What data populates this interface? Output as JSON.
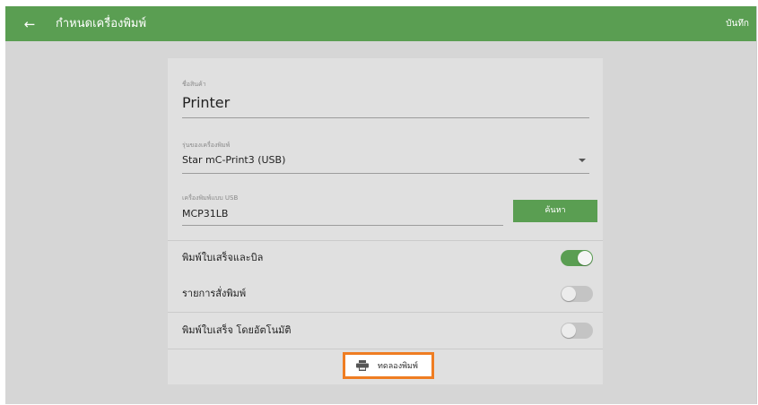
{
  "app_bar": {
    "back_icon": "arrow-left-icon",
    "title": "กำหนดเครื่องพิมพ์",
    "save_label": "บันทึก",
    "color": "#5a9e52"
  },
  "form": {
    "product_name": {
      "label": "ชื่อสินค้า",
      "value": "Printer"
    },
    "printer_model": {
      "label": "รุ่นของเครื่องพิมพ์",
      "value": "Star mC-Print3 (USB)"
    },
    "usb_printer": {
      "label": "เครื่องพิมพ์แบบ USB",
      "value": "MCP31LB",
      "search_label": "ค้นหา"
    }
  },
  "toggles": [
    {
      "label": "พิมพ์ใบเสร็จและบิล",
      "state": "on"
    },
    {
      "label": "รายการสั่งพิมพ์",
      "state": "off"
    },
    {
      "label": "พิมพ์ใบเสร็จ โดยอัตโนมัติ",
      "state": "off"
    }
  ],
  "test_print": {
    "label": "ทดลองพิมพ์",
    "icon": "printer-icon",
    "highlight_color": "#ef7d22"
  }
}
